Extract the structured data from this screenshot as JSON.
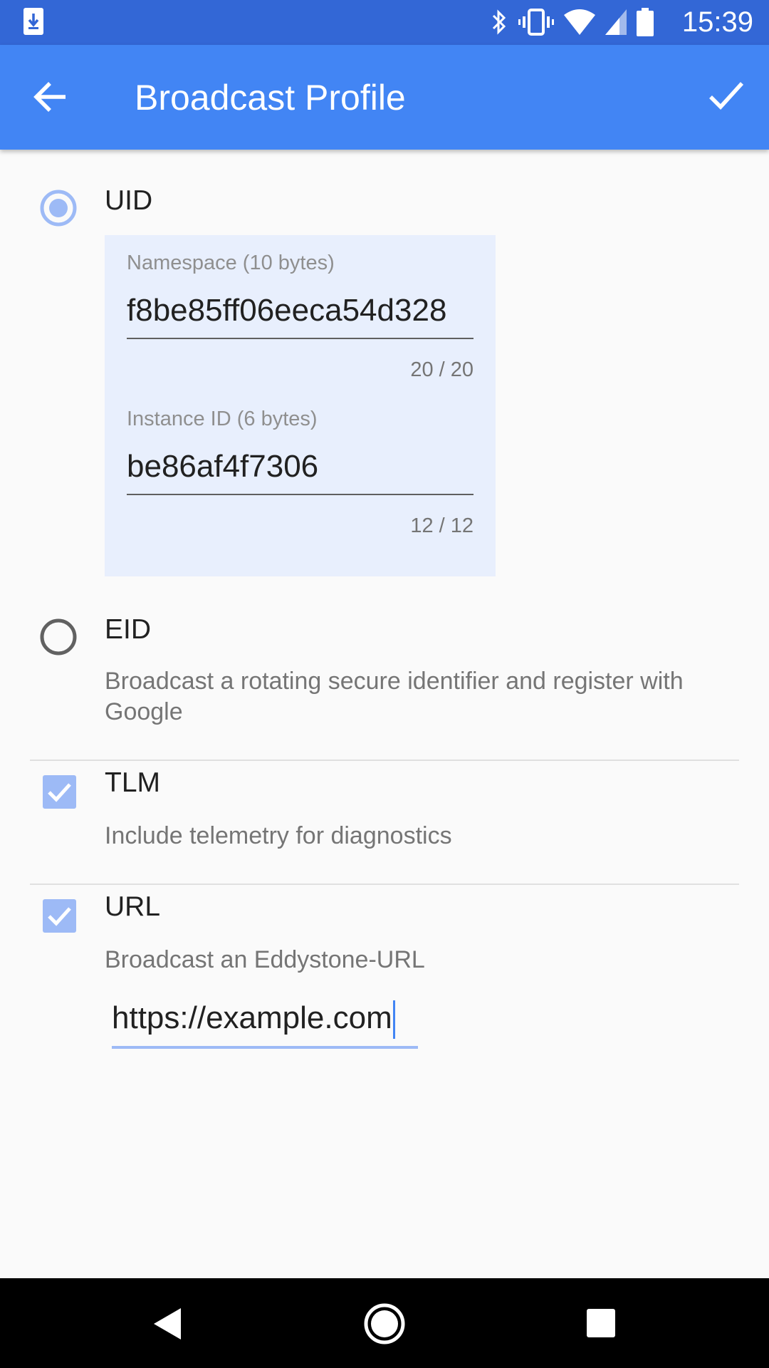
{
  "status_bar": {
    "time": "15:39",
    "icons": [
      "download-icon",
      "bluetooth-icon",
      "vibrate-icon",
      "wifi-icon",
      "signal-icon",
      "battery-icon"
    ]
  },
  "app_bar": {
    "title": "Broadcast Profile",
    "back_icon": "arrow-back-icon",
    "confirm_icon": "check-icon"
  },
  "uid": {
    "label": "UID",
    "selected": true,
    "namespace": {
      "label": "Namespace (10 bytes)",
      "value": "f8be85ff06eeca54d328",
      "counter": "20 / 20"
    },
    "instance": {
      "label": "Instance ID (6 bytes)",
      "value": "be86af4f7306",
      "counter": "12 / 12"
    }
  },
  "eid": {
    "label": "EID",
    "selected": false,
    "description": "Broadcast a rotating secure identifier and register with Google"
  },
  "tlm": {
    "label": "TLM",
    "checked": true,
    "description": "Include telemetry for diagnostics"
  },
  "url": {
    "label": "URL",
    "checked": true,
    "description": "Broadcast an Eddystone-URL",
    "value": "https://example.com"
  },
  "colors": {
    "status_bar": "#3367d6",
    "app_bar": "#4285f4",
    "accent_light": "#9dbaf6",
    "uid_panel": "#e8effd"
  }
}
